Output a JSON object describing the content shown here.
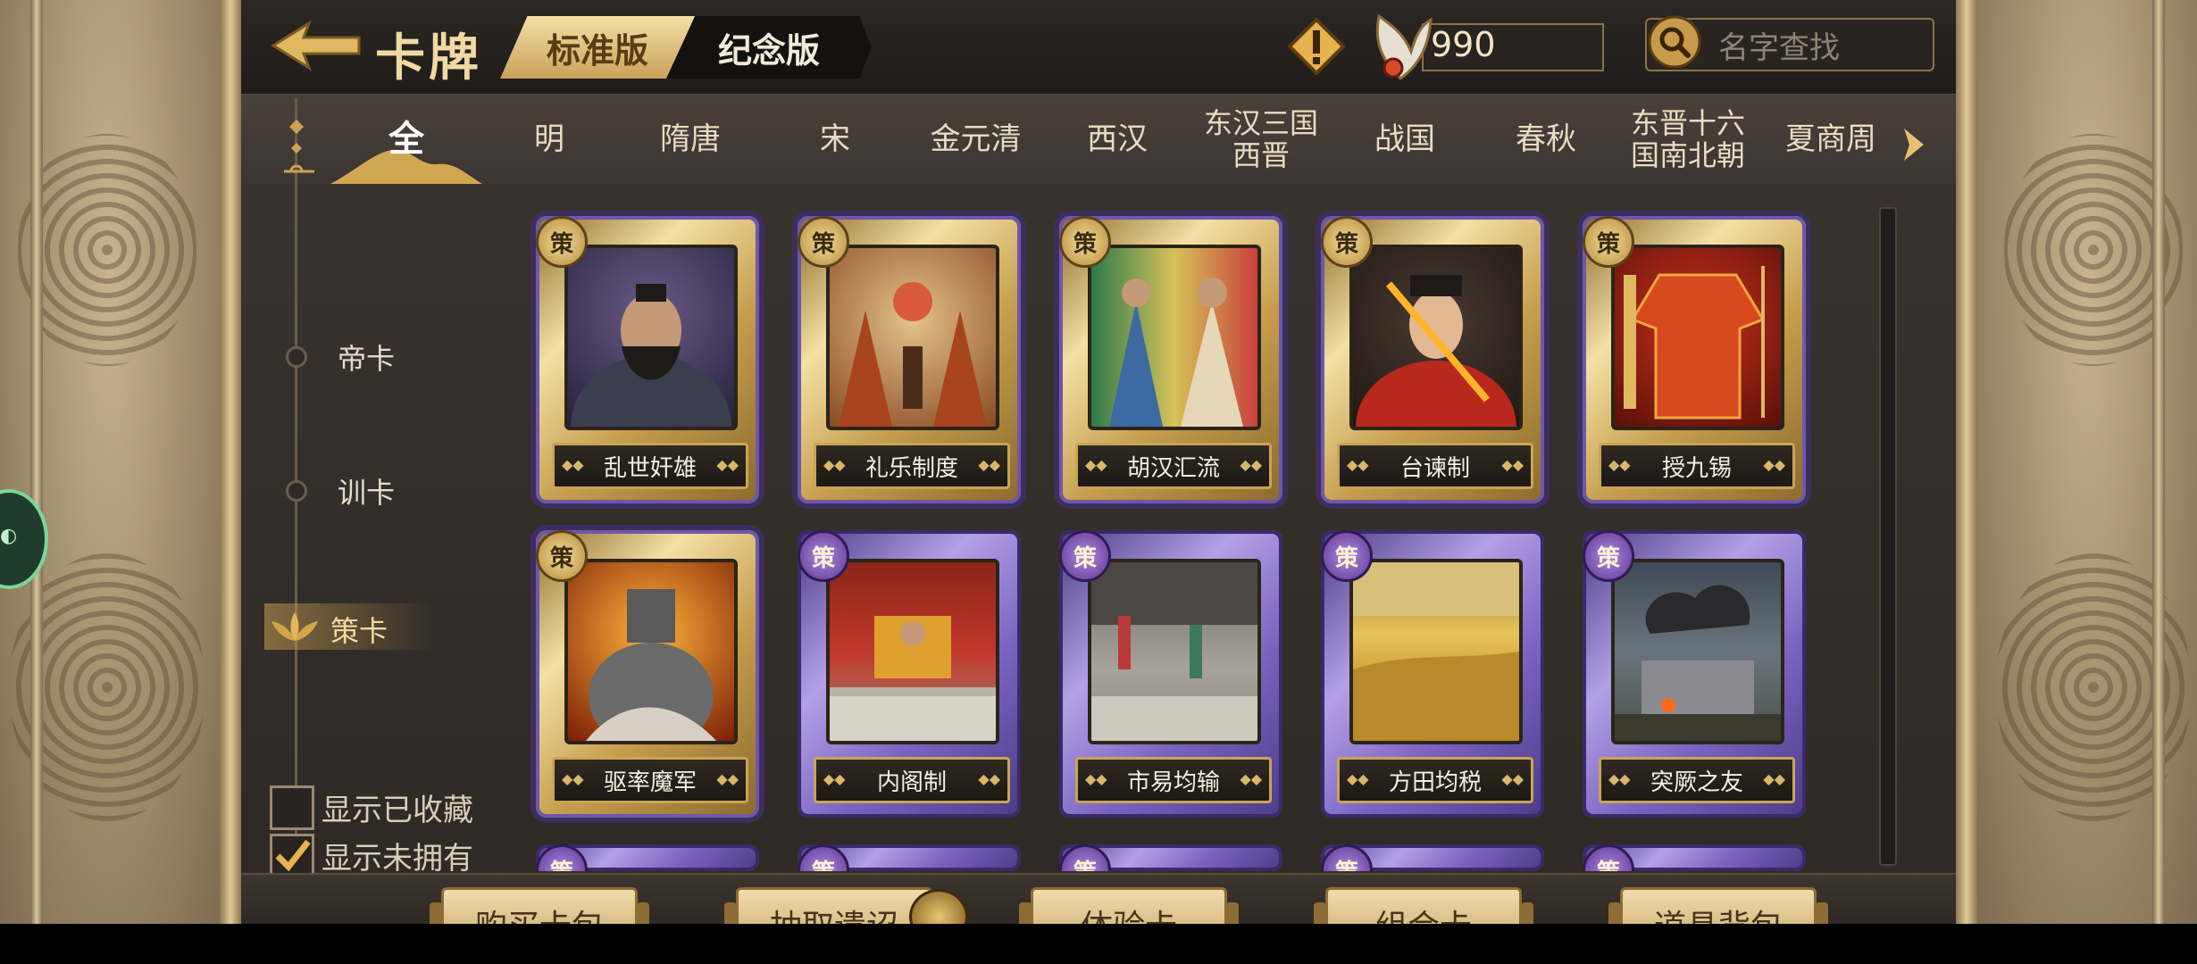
{
  "header": {
    "title": "卡牌",
    "tabs": [
      {
        "label": "标准版",
        "active": true
      },
      {
        "label": "纪念版",
        "active": false
      }
    ],
    "currency_value": "990",
    "search_placeholder": "名字查找"
  },
  "eras": [
    {
      "label": "全",
      "active": true
    },
    {
      "label": "明"
    },
    {
      "label": "隋唐"
    },
    {
      "label": "宋"
    },
    {
      "label": "金元清"
    },
    {
      "label": "西汉"
    },
    {
      "label": "东汉三国\n西晋"
    },
    {
      "label": "战国"
    },
    {
      "label": "春秋"
    },
    {
      "label": "东晋十六\n国南北朝"
    },
    {
      "label": "夏商周"
    }
  ],
  "categories": [
    {
      "label": "帝卡"
    },
    {
      "label": "训卡"
    },
    {
      "label": "策卡",
      "active": true
    }
  ],
  "filters": {
    "show_collected": {
      "label": "显示已收藏",
      "checked": false
    },
    "show_unowned": {
      "label": "显示未拥有",
      "checked": true
    }
  },
  "cards": [
    {
      "name": "乱世奸雄",
      "badge": "策",
      "rarity": "gold"
    },
    {
      "name": "礼乐制度",
      "badge": "策",
      "rarity": "gold"
    },
    {
      "name": "胡汉汇流",
      "badge": "策",
      "rarity": "gold"
    },
    {
      "name": "台谏制",
      "badge": "策",
      "rarity": "gold"
    },
    {
      "name": "授九锡",
      "badge": "策",
      "rarity": "gold"
    },
    {
      "name": "驱率魔军",
      "badge": "策",
      "rarity": "gold"
    },
    {
      "name": "内阁制",
      "badge": "策",
      "rarity": "purple"
    },
    {
      "name": "市易均输",
      "badge": "策",
      "rarity": "purple"
    },
    {
      "name": "方田均税",
      "badge": "策",
      "rarity": "purple"
    },
    {
      "name": "突厥之友",
      "badge": "策",
      "rarity": "purple"
    }
  ],
  "bottom_buttons": [
    {
      "label": "购买卡包"
    },
    {
      "label": "抽取遗诏"
    },
    {
      "label": "体验卡"
    },
    {
      "label": "组合卡"
    },
    {
      "label": "道具背包"
    }
  ],
  "colors": {
    "gold_frame": "#e6c97e",
    "purple_frame": "#8f78d0",
    "accent_text": "#f1d9a4"
  }
}
